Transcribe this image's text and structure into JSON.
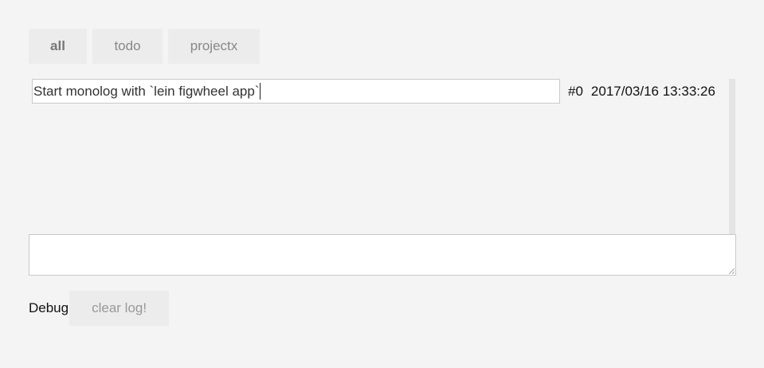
{
  "tabs": [
    {
      "label": "all",
      "active": true
    },
    {
      "label": "todo",
      "active": false
    },
    {
      "label": "projectx",
      "active": false
    }
  ],
  "entries": [
    {
      "text": "Start monolog with `lein figwheel app`",
      "id": "#0",
      "timestamp": "2017/03/16 13:33:26"
    }
  ],
  "new_entry": {
    "value": ""
  },
  "footer": {
    "debug_label": "Debug",
    "clear_label": "clear log!"
  }
}
